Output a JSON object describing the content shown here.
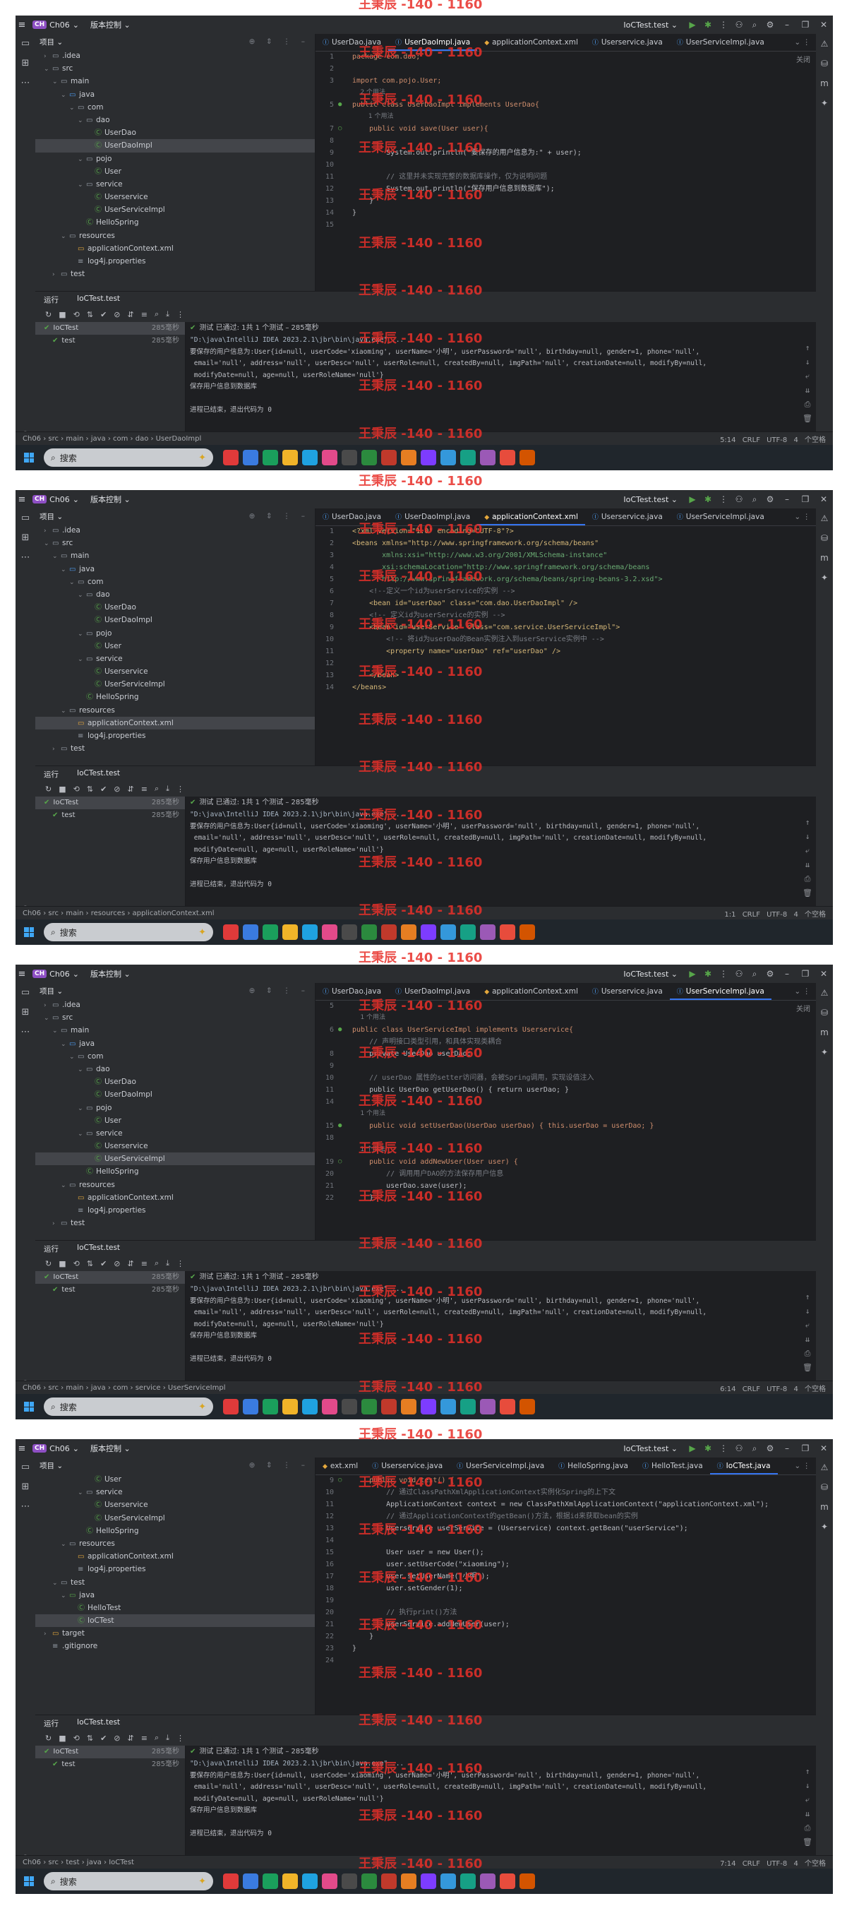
{
  "colors": {
    "bg": "#1e1f22",
    "chrome": "#2b2d30",
    "accent": "#3574f0",
    "pass": "#57a64a",
    "watermark": "#e8302a"
  },
  "common": {
    "project_badge": "CH",
    "project_name": "Ch06",
    "vcs_label": "版本控制",
    "run_config": "IoCTest.test",
    "tree_header": "项目",
    "run_label": "运行",
    "run_tab": "IoCTest.test",
    "run_tree": [
      {
        "name": "IoCTest",
        "time": "285毫秒"
      },
      {
        "name": "test",
        "time": "285毫秒"
      }
    ],
    "pass_text": "测试 已通过: 1共 1 个测试 – 285毫秒",
    "console_lines": [
      "\"D:\\java\\IntelliJ IDEA 2023.2.1\\jbr\\bin\\java.exe\" ...",
      "要保存的用户信息为:User{id=null, userCode='xiaoming', userName='小明', userPassword='null', birthday=null, gender=1, phone='null',",
      " email='null', address='null', userDesc='null', userRole=null, createdBy=null, imgPath='null', creationDate=null, modifyBy=null,",
      " modifyDate=null, age=null, userRoleName='null'}",
      "保存用户信息到数据库",
      "",
      "进程已结束，退出代码为 0"
    ],
    "search_placeholder": "搜索",
    "watermark": "王秉辰 -140 - 1160"
  },
  "screens": [
    {
      "tabs": [
        "UserDao.java",
        "UserDaoImpl.java",
        "applicationContext.xml",
        "Userservice.java",
        "UserServiceImpl.java"
      ],
      "active_tab": 1,
      "close_hint": "关闭",
      "tree": [
        {
          "lvl": 1,
          "arrow": "›",
          "ic": "folder",
          "t": ".idea"
        },
        {
          "lvl": 1,
          "arrow": "⌄",
          "ic": "folder",
          "t": "src"
        },
        {
          "lvl": 2,
          "arrow": "⌄",
          "ic": "folder",
          "t": "main"
        },
        {
          "lvl": 3,
          "arrow": "⌄",
          "ic": "java",
          "t": "java"
        },
        {
          "lvl": 4,
          "arrow": "⌄",
          "ic": "folder",
          "t": "com"
        },
        {
          "lvl": 5,
          "arrow": "⌄",
          "ic": "folder",
          "t": "dao"
        },
        {
          "lvl": 6,
          "arrow": "",
          "ic": "class",
          "t": "UserDao"
        },
        {
          "lvl": 6,
          "arrow": "",
          "ic": "class",
          "t": "UserDaoImpl",
          "sel": true
        },
        {
          "lvl": 5,
          "arrow": "⌄",
          "ic": "folder",
          "t": "pojo"
        },
        {
          "lvl": 6,
          "arrow": "",
          "ic": "class",
          "t": "User"
        },
        {
          "lvl": 5,
          "arrow": "⌄",
          "ic": "folder",
          "t": "service"
        },
        {
          "lvl": 6,
          "arrow": "",
          "ic": "class",
          "t": "Userservice"
        },
        {
          "lvl": 6,
          "arrow": "",
          "ic": "class",
          "t": "UserServiceImpl"
        },
        {
          "lvl": 5,
          "arrow": "",
          "ic": "class",
          "t": "HelloSpring"
        },
        {
          "lvl": 3,
          "arrow": "⌄",
          "ic": "folder",
          "t": "resources"
        },
        {
          "lvl": 4,
          "arrow": "",
          "ic": "xml",
          "t": "applicationContext.xml"
        },
        {
          "lvl": 4,
          "arrow": "",
          "ic": "prop",
          "t": "log4j.properties"
        },
        {
          "lvl": 2,
          "arrow": "›",
          "ic": "folder",
          "t": "test"
        }
      ],
      "code": [
        {
          "n": "1",
          "s": "kw",
          "t": "package com.dao;"
        },
        {
          "n": "2",
          "s": "",
          "t": ""
        },
        {
          "n": "3",
          "s": "kw",
          "t": "import com.pojo.User;"
        },
        {
          "n": "",
          "s": "hint",
          "t": "    2 个用法"
        },
        {
          "n": "5",
          "s": "kw",
          "g": "●",
          "t": "public class UserDaoImpl implements UserDao{"
        },
        {
          "n": "",
          "s": "hint",
          "t": "        1 个用法"
        },
        {
          "n": "7",
          "s": "kw",
          "g": "○",
          "t": "    public void save(User user){"
        },
        {
          "n": "8",
          "s": "",
          "t": ""
        },
        {
          "n": "9",
          "s": "pr",
          "t": "        System.out.println(\"要保存的用户信息为:\" + user);"
        },
        {
          "n": "10",
          "s": "",
          "t": ""
        },
        {
          "n": "11",
          "s": "cm",
          "t": "        // 这里并未实现完整的数据库操作，仅为说明问题"
        },
        {
          "n": "12",
          "s": "pr",
          "t": "        System.out.println(\"保存用户信息到数据库\");"
        },
        {
          "n": "13",
          "s": "pr",
          "t": "    }"
        },
        {
          "n": "14",
          "s": "pr",
          "t": "}"
        },
        {
          "n": "15",
          "s": "",
          "t": ""
        }
      ],
      "breadcrumb": "Ch06 › src › main › java › com › dao › UserDaoImpl",
      "status_right": "5:14 CRLF UTF-8 4 个空格"
    },
    {
      "tabs": [
        "UserDao.java",
        "UserDaoImpl.java",
        "applicationContext.xml",
        "Userservice.java",
        "UserServiceImpl.java"
      ],
      "active_tab": 2,
      "close_hint": "",
      "tree": [
        {
          "lvl": 1,
          "arrow": "›",
          "ic": "folder",
          "t": ".idea"
        },
        {
          "lvl": 1,
          "arrow": "⌄",
          "ic": "folder",
          "t": "src"
        },
        {
          "lvl": 2,
          "arrow": "⌄",
          "ic": "folder",
          "t": "main"
        },
        {
          "lvl": 3,
          "arrow": "⌄",
          "ic": "java",
          "t": "java"
        },
        {
          "lvl": 4,
          "arrow": "⌄",
          "ic": "folder",
          "t": "com"
        },
        {
          "lvl": 5,
          "arrow": "⌄",
          "ic": "folder",
          "t": "dao"
        },
        {
          "lvl": 6,
          "arrow": "",
          "ic": "class",
          "t": "UserDao"
        },
        {
          "lvl": 6,
          "arrow": "",
          "ic": "class",
          "t": "UserDaoImpl"
        },
        {
          "lvl": 5,
          "arrow": "⌄",
          "ic": "folder",
          "t": "pojo"
        },
        {
          "lvl": 6,
          "arrow": "",
          "ic": "class",
          "t": "User"
        },
        {
          "lvl": 5,
          "arrow": "⌄",
          "ic": "folder",
          "t": "service"
        },
        {
          "lvl": 6,
          "arrow": "",
          "ic": "class",
          "t": "Userservice"
        },
        {
          "lvl": 6,
          "arrow": "",
          "ic": "class",
          "t": "UserServiceImpl"
        },
        {
          "lvl": 5,
          "arrow": "",
          "ic": "class",
          "t": "HelloSpring"
        },
        {
          "lvl": 3,
          "arrow": "⌄",
          "ic": "folder",
          "t": "resources"
        },
        {
          "lvl": 4,
          "arrow": "",
          "ic": "xml",
          "t": "applicationContext.xml",
          "sel": true
        },
        {
          "lvl": 4,
          "arrow": "",
          "ic": "prop",
          "t": "log4j.properties"
        },
        {
          "lvl": 2,
          "arrow": "›",
          "ic": "folder",
          "t": "test"
        }
      ],
      "code": [
        {
          "n": "1",
          "s": "xml",
          "t": "<?xml version=\"1.0\" encoding=\"UTF-8\"?>"
        },
        {
          "n": "2",
          "s": "xml",
          "t": "<beans xmlns=\"http://www.springframework.org/schema/beans\""
        },
        {
          "n": "3",
          "s": "str",
          "t": "       xmlns:xsi=\"http://www.w3.org/2001/XMLSchema-instance\""
        },
        {
          "n": "4",
          "s": "str",
          "t": "       xsi:schemaLocation=\"http://www.springframework.org/schema/beans"
        },
        {
          "n": "5",
          "s": "str",
          "t": "       http://www.springframework.org/schema/beans/spring-beans-3.2.xsd\">"
        },
        {
          "n": "6",
          "s": "cm",
          "t": "    <!--定义一个id为userService的实例 -->"
        },
        {
          "n": "7",
          "s": "xml",
          "t": "    <bean id=\"userDao\" class=\"com.dao.UserDaoImpl\" />"
        },
        {
          "n": "8",
          "s": "cm",
          "t": "    <!-- 定义id为userService的实例 -->"
        },
        {
          "n": "9",
          "s": "xml",
          "t": "    <bean id=\"userService\" class=\"com.service.UserServiceImpl\">"
        },
        {
          "n": "10",
          "s": "cm",
          "t": "        <!-- 将id为userDao的Bean实例注入到userService实例中 -->"
        },
        {
          "n": "11",
          "s": "xml",
          "t": "        <property name=\"userDao\" ref=\"userDao\" />"
        },
        {
          "n": "12",
          "s": "",
          "t": ""
        },
        {
          "n": "13",
          "s": "xml",
          "t": "    </bean>"
        },
        {
          "n": "14",
          "s": "xml",
          "t": "</beans>"
        }
      ],
      "breadcrumb": "Ch06 › src › main › resources › applicationContext.xml",
      "status_right": "1:1 CRLF UTF-8 4 个空格"
    },
    {
      "tabs": [
        "UserDao.java",
        "UserDaoImpl.java",
        "applicationContext.xml",
        "Userservice.java",
        "UserServiceImpl.java"
      ],
      "active_tab": 4,
      "close_hint": "关闭",
      "tree": [
        {
          "lvl": 1,
          "arrow": "›",
          "ic": "folder",
          "t": ".idea"
        },
        {
          "lvl": 1,
          "arrow": "⌄",
          "ic": "folder",
          "t": "src"
        },
        {
          "lvl": 2,
          "arrow": "⌄",
          "ic": "folder",
          "t": "main"
        },
        {
          "lvl": 3,
          "arrow": "⌄",
          "ic": "java",
          "t": "java"
        },
        {
          "lvl": 4,
          "arrow": "⌄",
          "ic": "folder",
          "t": "com"
        },
        {
          "lvl": 5,
          "arrow": "⌄",
          "ic": "folder",
          "t": "dao"
        },
        {
          "lvl": 6,
          "arrow": "",
          "ic": "class",
          "t": "UserDao"
        },
        {
          "lvl": 6,
          "arrow": "",
          "ic": "class",
          "t": "UserDaoImpl"
        },
        {
          "lvl": 5,
          "arrow": "⌄",
          "ic": "folder",
          "t": "pojo"
        },
        {
          "lvl": 6,
          "arrow": "",
          "ic": "class",
          "t": "User"
        },
        {
          "lvl": 5,
          "arrow": "⌄",
          "ic": "folder",
          "t": "service"
        },
        {
          "lvl": 6,
          "arrow": "",
          "ic": "class",
          "t": "Userservice"
        },
        {
          "lvl": 6,
          "arrow": "",
          "ic": "class",
          "t": "UserServiceImpl",
          "sel": true
        },
        {
          "lvl": 5,
          "arrow": "",
          "ic": "class",
          "t": "HelloSpring"
        },
        {
          "lvl": 3,
          "arrow": "⌄",
          "ic": "folder",
          "t": "resources"
        },
        {
          "lvl": 4,
          "arrow": "",
          "ic": "xml",
          "t": "applicationContext.xml"
        },
        {
          "lvl": 4,
          "arrow": "",
          "ic": "prop",
          "t": "log4j.properties"
        },
        {
          "lvl": 2,
          "arrow": "›",
          "ic": "folder",
          "t": "test"
        }
      ],
      "code": [
        {
          "n": "5",
          "s": "",
          "t": ""
        },
        {
          "n": "",
          "s": "hint",
          "t": "    1 个用法"
        },
        {
          "n": "6",
          "s": "kw",
          "g": "●",
          "t": "public class UserServiceImpl implements Userservice{"
        },
        {
          "n": "",
          "s": "cm",
          "t": "    // 声明接口类型引用，和具体实现类耦合"
        },
        {
          "n": "8",
          "s": "pr",
          "t": "    private UserDao userDao;"
        },
        {
          "n": "9",
          "s": "",
          "t": ""
        },
        {
          "n": "10",
          "s": "cm",
          "t": "    // userDao 属性的setter访问器，会被Spring调用，实现设值注入"
        },
        {
          "n": "11",
          "s": "pr",
          "t": "    public UserDao getUserDao() { return userDao; }"
        },
        {
          "n": "14",
          "s": "",
          "t": ""
        },
        {
          "n": "",
          "s": "hint",
          "t": "    1 个用法"
        },
        {
          "n": "15",
          "s": "kw",
          "g": "●",
          "t": "    public void setUserDao(UserDao userDao) { this.userDao = userDao; }"
        },
        {
          "n": "18",
          "s": "",
          "t": ""
        },
        {
          "n": "",
          "s": "hint",
          "t": "    1 个用法"
        },
        {
          "n": "19",
          "s": "kw",
          "g": "○",
          "t": "    public void addNewUser(User user) {"
        },
        {
          "n": "20",
          "s": "cm",
          "t": "        // 调用用户DAO的方法保存用户信息"
        },
        {
          "n": "21",
          "s": "pr",
          "t": "        userDao.save(user);"
        },
        {
          "n": "22",
          "s": "pr",
          "t": "    }"
        }
      ],
      "breadcrumb": "Ch06 › src › main › java › com › service › UserServiceImpl",
      "status_right": "6:14 CRLF UTF-8 4 个空格"
    },
    {
      "tabs": [
        "ext.xml",
        "Userservice.java",
        "UserServiceImpl.java",
        "HelloSpring.java",
        "HelloTest.java",
        "IoCTest.java"
      ],
      "active_tab": 5,
      "close_hint": "",
      "tree": [
        {
          "lvl": 6,
          "arrow": "",
          "ic": "class",
          "t": "User"
        },
        {
          "lvl": 5,
          "arrow": "⌄",
          "ic": "folder",
          "t": "service"
        },
        {
          "lvl": 6,
          "arrow": "",
          "ic": "class",
          "t": "Userservice"
        },
        {
          "lvl": 6,
          "arrow": "",
          "ic": "class",
          "t": "UserServiceImpl"
        },
        {
          "lvl": 5,
          "arrow": "",
          "ic": "class",
          "t": "HelloSpring"
        },
        {
          "lvl": 3,
          "arrow": "⌄",
          "ic": "folder",
          "t": "resources"
        },
        {
          "lvl": 4,
          "arrow": "",
          "ic": "xml",
          "t": "applicationContext.xml"
        },
        {
          "lvl": 4,
          "arrow": "",
          "ic": "prop",
          "t": "log4j.properties"
        },
        {
          "lvl": 2,
          "arrow": "⌄",
          "ic": "folder",
          "t": "test"
        },
        {
          "lvl": 3,
          "arrow": "⌄",
          "ic": "test",
          "t": "java"
        },
        {
          "lvl": 4,
          "arrow": "",
          "ic": "class",
          "t": "HelloTest"
        },
        {
          "lvl": 4,
          "arrow": "",
          "ic": "class",
          "t": "IoCTest",
          "sel": true
        },
        {
          "lvl": 1,
          "arrow": "›",
          "ic": "xml",
          "t": "target"
        },
        {
          "lvl": 1,
          "arrow": "",
          "ic": "prop",
          "t": ".gitignore"
        }
      ],
      "code": [
        {
          "n": "9",
          "s": "kw",
          "g": "○",
          "t": "    public void test() {"
        },
        {
          "n": "10",
          "s": "cm",
          "t": "        // 通过ClassPathXmlApplicationContext实例化Spring的上下文"
        },
        {
          "n": "11",
          "s": "pr",
          "t": "        ApplicationContext context = new ClassPathXmlApplicationContext(\"applicationContext.xml\");"
        },
        {
          "n": "12",
          "s": "cm",
          "t": "        // 通过ApplicationContext的getBean()方法，根据id来获取bean的实例"
        },
        {
          "n": "13",
          "s": "pr",
          "t": "        Userservice userService = (Userservice) context.getBean(\"userService\");"
        },
        {
          "n": "14",
          "s": "",
          "t": ""
        },
        {
          "n": "15",
          "s": "pr",
          "t": "        User user = new User();"
        },
        {
          "n": "16",
          "s": "pr",
          "t": "        user.setUserCode(\"xiaoming\");"
        },
        {
          "n": "17",
          "s": "pr",
          "t": "        user.setUserName(\"小明\");"
        },
        {
          "n": "18",
          "s": "pr",
          "t": "        user.setGender(1);"
        },
        {
          "n": "19",
          "s": "",
          "t": ""
        },
        {
          "n": "20",
          "s": "cm",
          "t": "        // 执行print()方法"
        },
        {
          "n": "21",
          "s": "pr",
          "t": "        userService.addNewUser(user);"
        },
        {
          "n": "22",
          "s": "pr",
          "t": "    }"
        },
        {
          "n": "23",
          "s": "pr",
          "t": "}"
        },
        {
          "n": "24",
          "s": "",
          "t": ""
        }
      ],
      "breadcrumb": "Ch06 › src › test › java › IoCTest",
      "status_right": "7:14 CRLF UTF-8 4 个空格"
    }
  ]
}
